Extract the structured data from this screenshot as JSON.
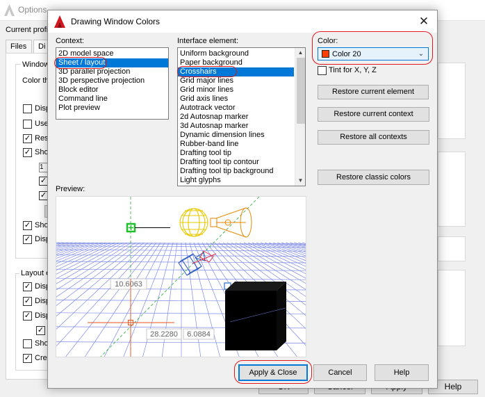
{
  "background_window": {
    "title": "Options",
    "current_profile_label": "Current profil",
    "tabs": [
      "Files",
      "Di"
    ],
    "group_window": "Window",
    "color_label": "Color th",
    "items_top": [
      {
        "text": "Disp",
        "checked": false
      },
      {
        "text": "Use",
        "checked": false
      },
      {
        "text": "Res",
        "checked": true
      },
      {
        "text": "Sho",
        "checked": true
      }
    ],
    "items_mid": [
      {
        "text": "Sho",
        "checked": true
      },
      {
        "text": "Disp",
        "checked": true
      }
    ],
    "group_layout": "Layout e",
    "items_layout": [
      {
        "text": "Disp",
        "checked": true
      },
      {
        "text": "Disp",
        "checked": true
      },
      {
        "text": "Disp",
        "checked": true
      },
      {
        "text": "Sho",
        "checked": false
      },
      {
        "text": "Crea",
        "checked": true
      }
    ],
    "buttons": [
      "OK",
      "Cancel",
      "Apply",
      "Help"
    ]
  },
  "dialog": {
    "title": "Drawing Window Colors",
    "close_glyph": "✕",
    "context_label": "Context:",
    "contexts": [
      "2D model space",
      "Sheet / layout",
      "3D parallel projection",
      "3D perspective projection",
      "Block editor",
      "Command line",
      "Plot preview"
    ],
    "context_selected": 1,
    "interface_label": "Interface element:",
    "interface_elements": [
      "Uniform background",
      "Paper background",
      "Crosshairs",
      "Grid major lines",
      "Grid minor lines",
      "Grid axis lines",
      "Autotrack vector",
      "2d Autosnap marker",
      "3d Autosnap marker",
      "Dynamic dimension lines",
      "Rubber-band line",
      "Drafting tool tip",
      "Drafting tool tip contour",
      "Drafting tool tip background",
      "Light glyphs"
    ],
    "interface_selected": 2,
    "color_label": "Color:",
    "color_value": "Color 20",
    "color_swatch": "#ff3f00",
    "tint_label": "Tint for X, Y, Z",
    "tint_checked": false,
    "buttons": {
      "restore_element": "Restore current element",
      "restore_context": "Restore current context",
      "restore_all": "Restore all contexts",
      "restore_classic": "Restore classic colors",
      "apply_close": "Apply & Close",
      "cancel": "Cancel",
      "help": "Help"
    },
    "preview_label": "Preview:",
    "preview_values": {
      "dim1": "10.6063",
      "dim2": "28.2280",
      "dim3": "6.0884"
    }
  },
  "colors": {
    "highlight": "#0078d7",
    "annotation_ring": "#e0161b",
    "grid": "#6f7fe6",
    "snap_marker": "#1fbf2b",
    "crosshair": "#e8501e",
    "light_glyph": "#f2d400",
    "spotlight": "#e58a00"
  }
}
